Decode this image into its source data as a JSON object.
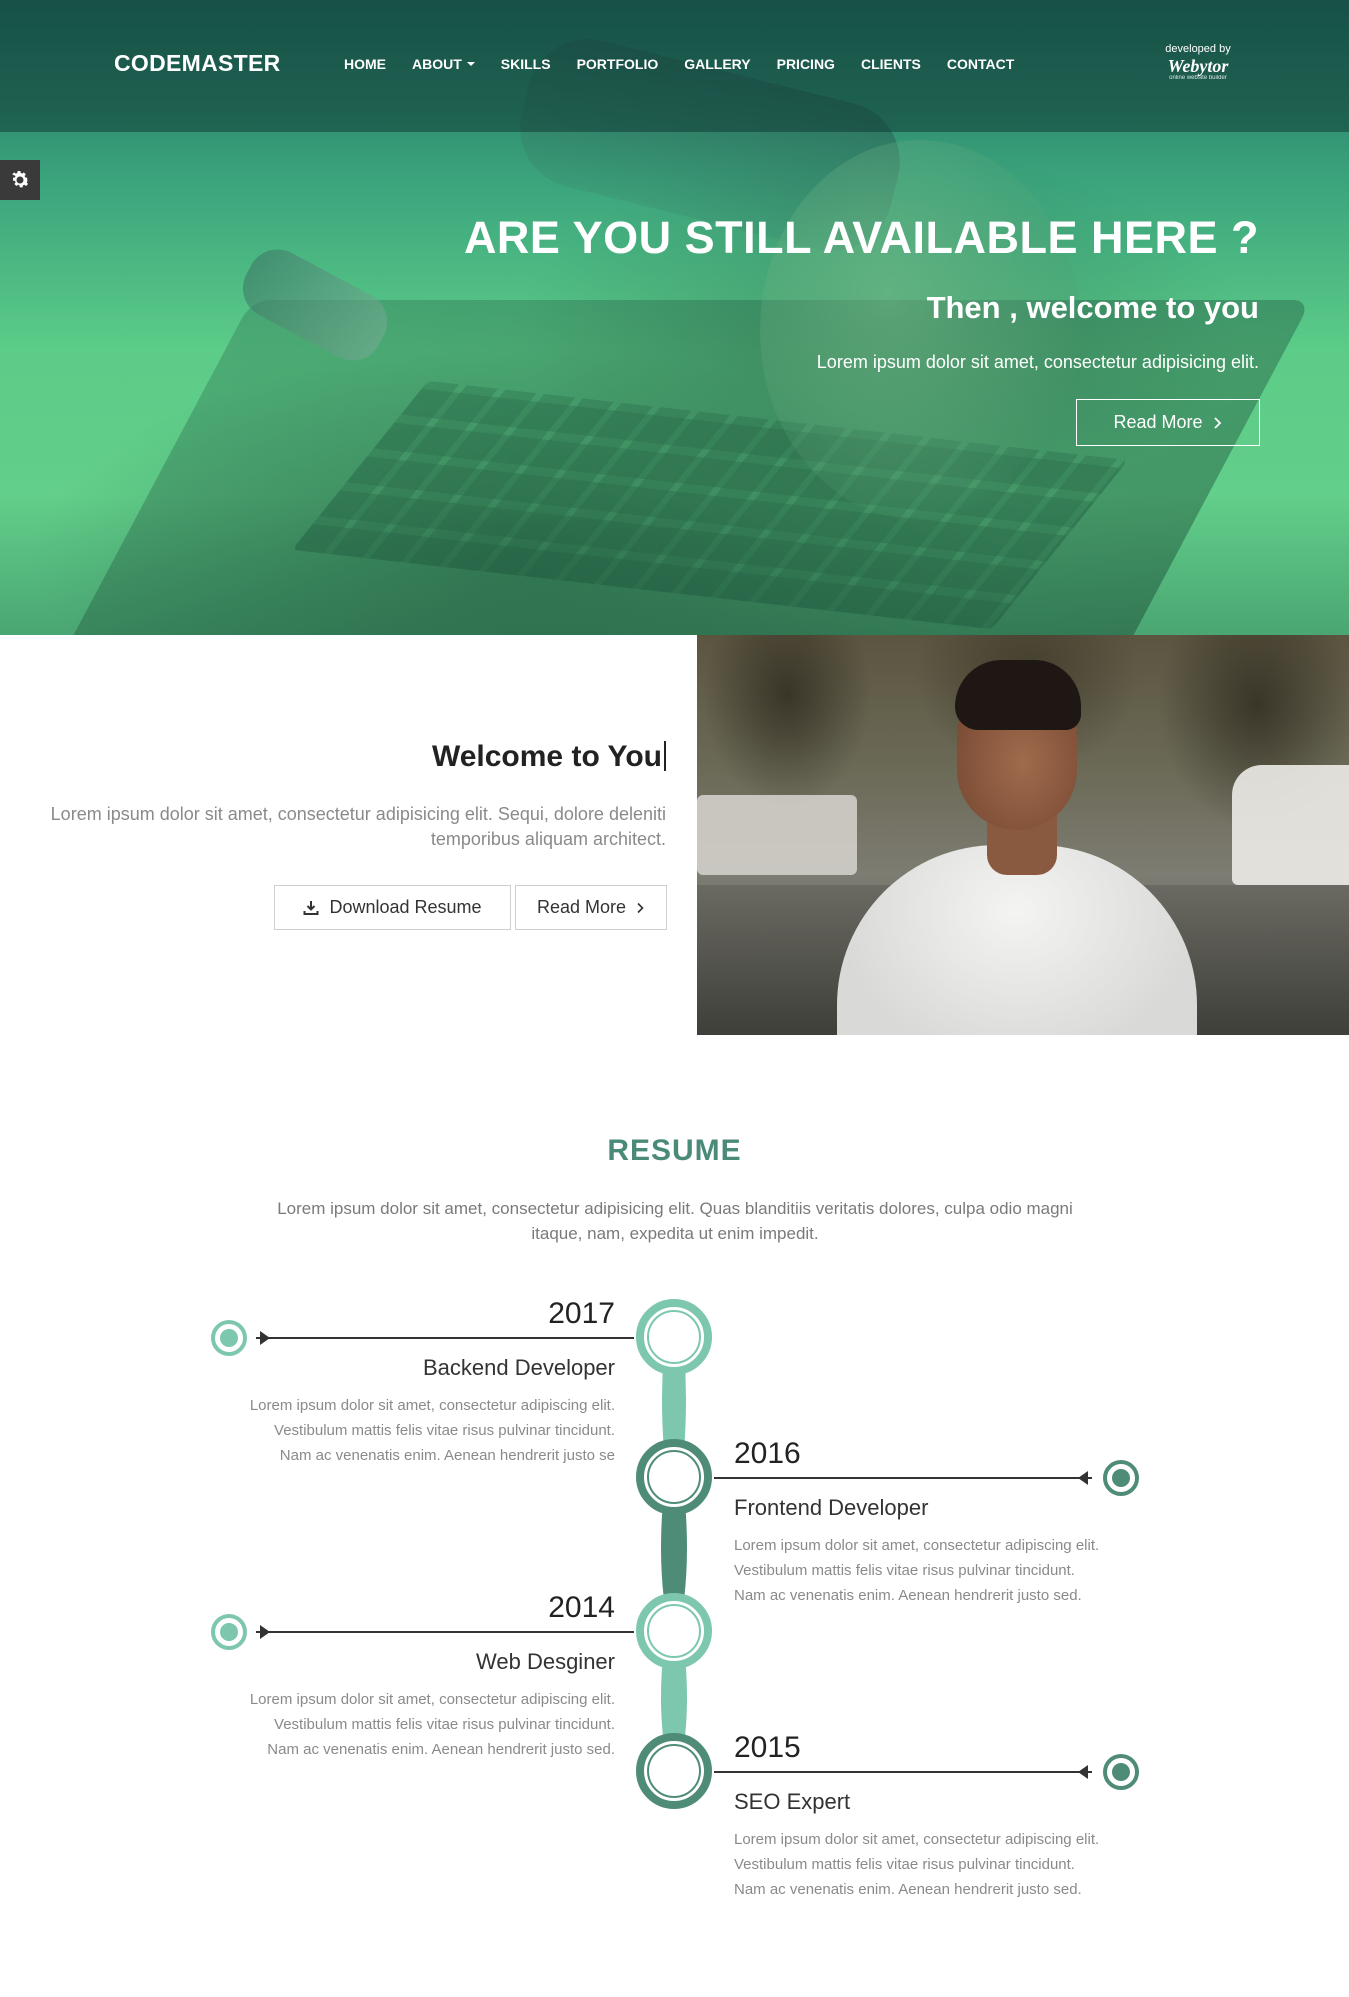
{
  "brand": "CODEMASTER",
  "nav": {
    "items": [
      "HOME",
      "ABOUT",
      "SKILLS",
      "PORTFOLIO",
      "GALLERY",
      "PRICING",
      "CLIENTS",
      "CONTACT"
    ]
  },
  "developer": {
    "small": "developed by",
    "logo": "Webytor",
    "tagline": "online website builder"
  },
  "hero": {
    "title": "ARE YOU STILL AVAILABLE HERE ?",
    "subtitle": "Then , welcome to you",
    "text": "Lorem ipsum dolor sit amet, consectetur adipisicing elit.",
    "button": "Read More"
  },
  "welcome": {
    "title": "Welcome to You",
    "text": "Lorem ipsum dolor sit amet, consectetur adipisicing elit. Sequi, dolore deleniti temporibus aliquam architect.",
    "download_button": "Download Resume",
    "read_button": "Read More"
  },
  "resume": {
    "title": "RESUME",
    "intro": "Lorem ipsum dolor sit amet, consectetur adipisicing elit. Quas blanditiis veritatis dolores, culpa odio magni itaque, nam, expedita ut enim impedit.",
    "entries": [
      {
        "year": "2017",
        "role": "Backend Developer",
        "text": "Lorem ipsum dolor sit amet, consectetur adipiscing elit. Vestibulum mattis felis vitae risus pulvinar tincidunt. Nam ac venenatis enim. Aenean hendrerit justo se"
      },
      {
        "year": "2016",
        "role": "Frontend Developer",
        "text": "Lorem ipsum dolor sit amet, consectetur adipiscing elit. Vestibulum mattis felis vitae risus pulvinar tincidunt. Nam ac venenatis enim. Aenean hendrerit justo sed."
      },
      {
        "year": "2014",
        "role": "Web Desginer",
        "text": "Lorem ipsum dolor sit amet, consectetur adipiscing elit. Vestibulum mattis felis vitae risus pulvinar tincidunt. Nam ac venenatis enim. Aenean hendrerit justo sed."
      },
      {
        "year": "2015",
        "role": "SEO Expert",
        "text": "Lorem ipsum dolor sit amet, consectetur adipiscing elit. Vestibulum mattis felis vitae risus pulvinar tincidunt. Nam ac venenatis enim. Aenean hendrerit justo sed."
      }
    ]
  },
  "colors": {
    "accent_light": "#7cc7ae",
    "accent_dark": "#4f8c78"
  },
  "icons": {
    "settings": "gear-icon",
    "download": "download-icon",
    "chevron": "chevron-right-icon"
  }
}
